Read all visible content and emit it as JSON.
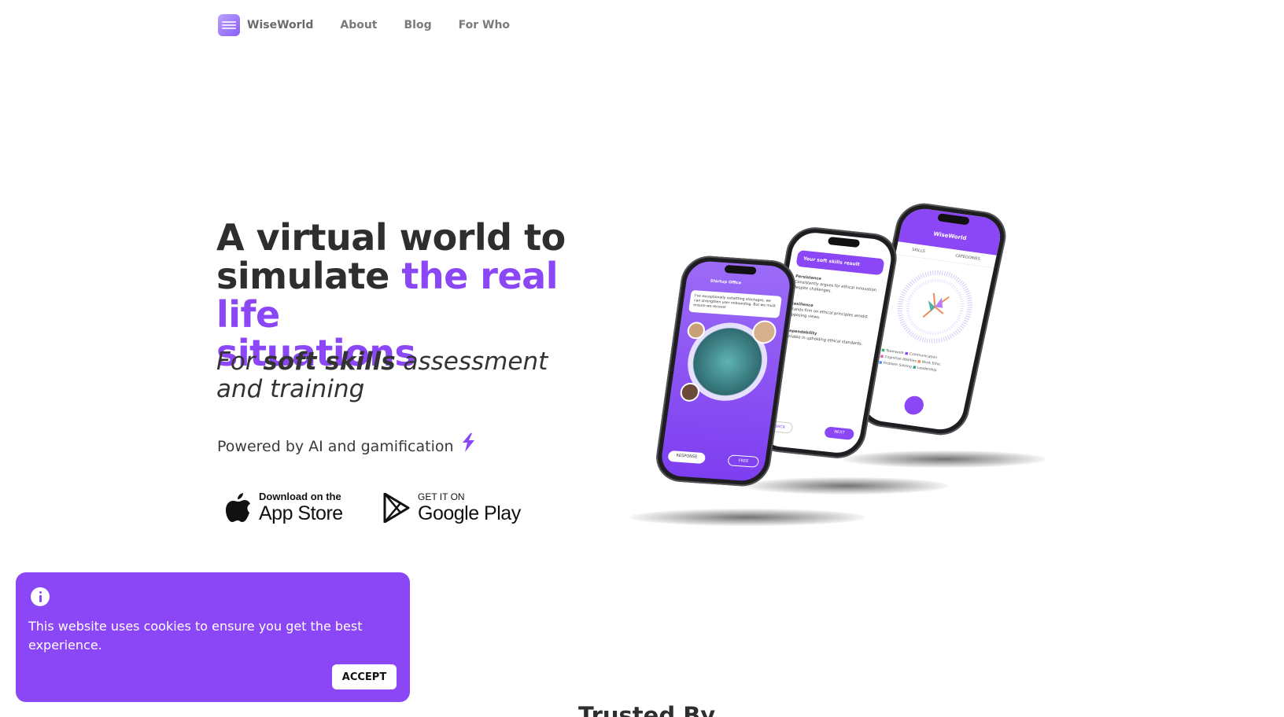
{
  "nav": {
    "brand": "WiseWorld",
    "links": [
      "About",
      "Blog",
      "For Who"
    ]
  },
  "hero": {
    "title_line1": "A virtual world to",
    "title_line2_plain": "simulate ",
    "title_line2_accent": "the real life",
    "title_line3_accent": "situations",
    "sub_pre": "For ",
    "sub_bold": "soft skills",
    "sub_post": " assessment",
    "sub_line2": "and training",
    "powered": "Powered by AI and gamification"
  },
  "stores": {
    "apple_small": "Download on the",
    "apple_big": "App Store",
    "google_small": "GET IT ON",
    "google_big": "Google Play"
  },
  "phones": {
    "front_header": "Startup Office",
    "front_bubble": "I've exceptionally outwitting stackages, we can strengthen user onboarding. But we must ensure we recover",
    "front_btn1": "RESPONSE",
    "front_btn2": "FREE",
    "mid_header": "Your soft skills result",
    "mid_items": [
      {
        "title": "Persistence",
        "desc": "Consistently argues for ethical innovation despite challenges."
      },
      {
        "title": "Resilience",
        "desc": "Stands firm on ethical principles amidst opposing views."
      },
      {
        "title": "Dependability",
        "desc": "Reliable in upholding ethical standards."
      }
    ],
    "mid_btn1": "BACK",
    "mid_btn2": "NEXT",
    "back_title": "WiseWorld",
    "back_tabs": [
      "SKILLS",
      "CATEGORIES"
    ],
    "back_legend": [
      "Teamwork",
      "Communication",
      "Cognitive Abilities",
      "Work Ethic",
      "Problem Solving",
      "Leadership"
    ]
  },
  "cookie": {
    "text": "This website uses cookies to ensure you get the best experience.",
    "accept": "ACCEPT"
  },
  "section": {
    "trusted": "Trusted By"
  },
  "colors": {
    "accent": "#8b46f6",
    "text": "#2e2e2e"
  }
}
